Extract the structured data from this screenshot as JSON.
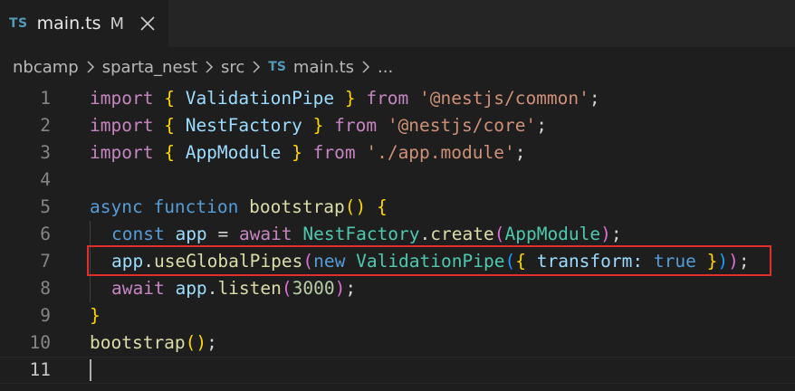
{
  "tab": {
    "lang_badge": "TS",
    "filename": "main.ts",
    "modified": "M"
  },
  "breadcrumb": {
    "items": [
      "nbcamp",
      "sparta_nest",
      "src",
      "main.ts",
      "..."
    ],
    "file_badge": "TS"
  },
  "editor": {
    "line_numbers": [
      "1",
      "2",
      "3",
      "4",
      "5",
      "6",
      "7",
      "8",
      "9",
      "10",
      "11"
    ],
    "l1": {
      "import": "import",
      "ob": "{",
      "name": "ValidationPipe",
      "cb": "}",
      "from": "from",
      "path": "'@nestjs/common'",
      "semi": ";"
    },
    "l2": {
      "import": "import",
      "ob": "{",
      "name": "NestFactory",
      "cb": "}",
      "from": "from",
      "path": "'@nestjs/core'",
      "semi": ";"
    },
    "l3": {
      "import": "import",
      "ob": "{",
      "name": "AppModule",
      "cb": "}",
      "from": "from",
      "path": "'./app.module'",
      "semi": ";"
    },
    "l5": {
      "async": "async",
      "function": "function",
      "name": "bootstrap",
      "po": "(",
      "pc": ")",
      "ob": "{"
    },
    "l6": {
      "const": "const",
      "var": "app",
      "eq": "=",
      "await": "await",
      "cls": "NestFactory",
      "dot": ".",
      "method": "create",
      "po": "(",
      "arg": "AppModule",
      "pc": ")",
      "semi": ";"
    },
    "l7": {
      "var": "app",
      "dot": ".",
      "method": "useGlobalPipes",
      "po": "(",
      "new": "new",
      "cls": "ValidationPipe",
      "po2": "(",
      "ob": "{",
      "prop": "transform",
      "colon": ":",
      "val": "true",
      "cb": "}",
      "pc2": ")",
      "pc": ")",
      "semi": ";"
    },
    "l8": {
      "await": "await",
      "var": "app",
      "dot": ".",
      "method": "listen",
      "po": "(",
      "num": "3000",
      "pc": ")",
      "semi": ";"
    },
    "l9": {
      "cb": "}"
    },
    "l10": {
      "fn": "bootstrap",
      "pp": "()",
      "semi": ";"
    }
  },
  "colors": {
    "highlight_border": "#e0302e",
    "background": "#1e1e1e"
  }
}
